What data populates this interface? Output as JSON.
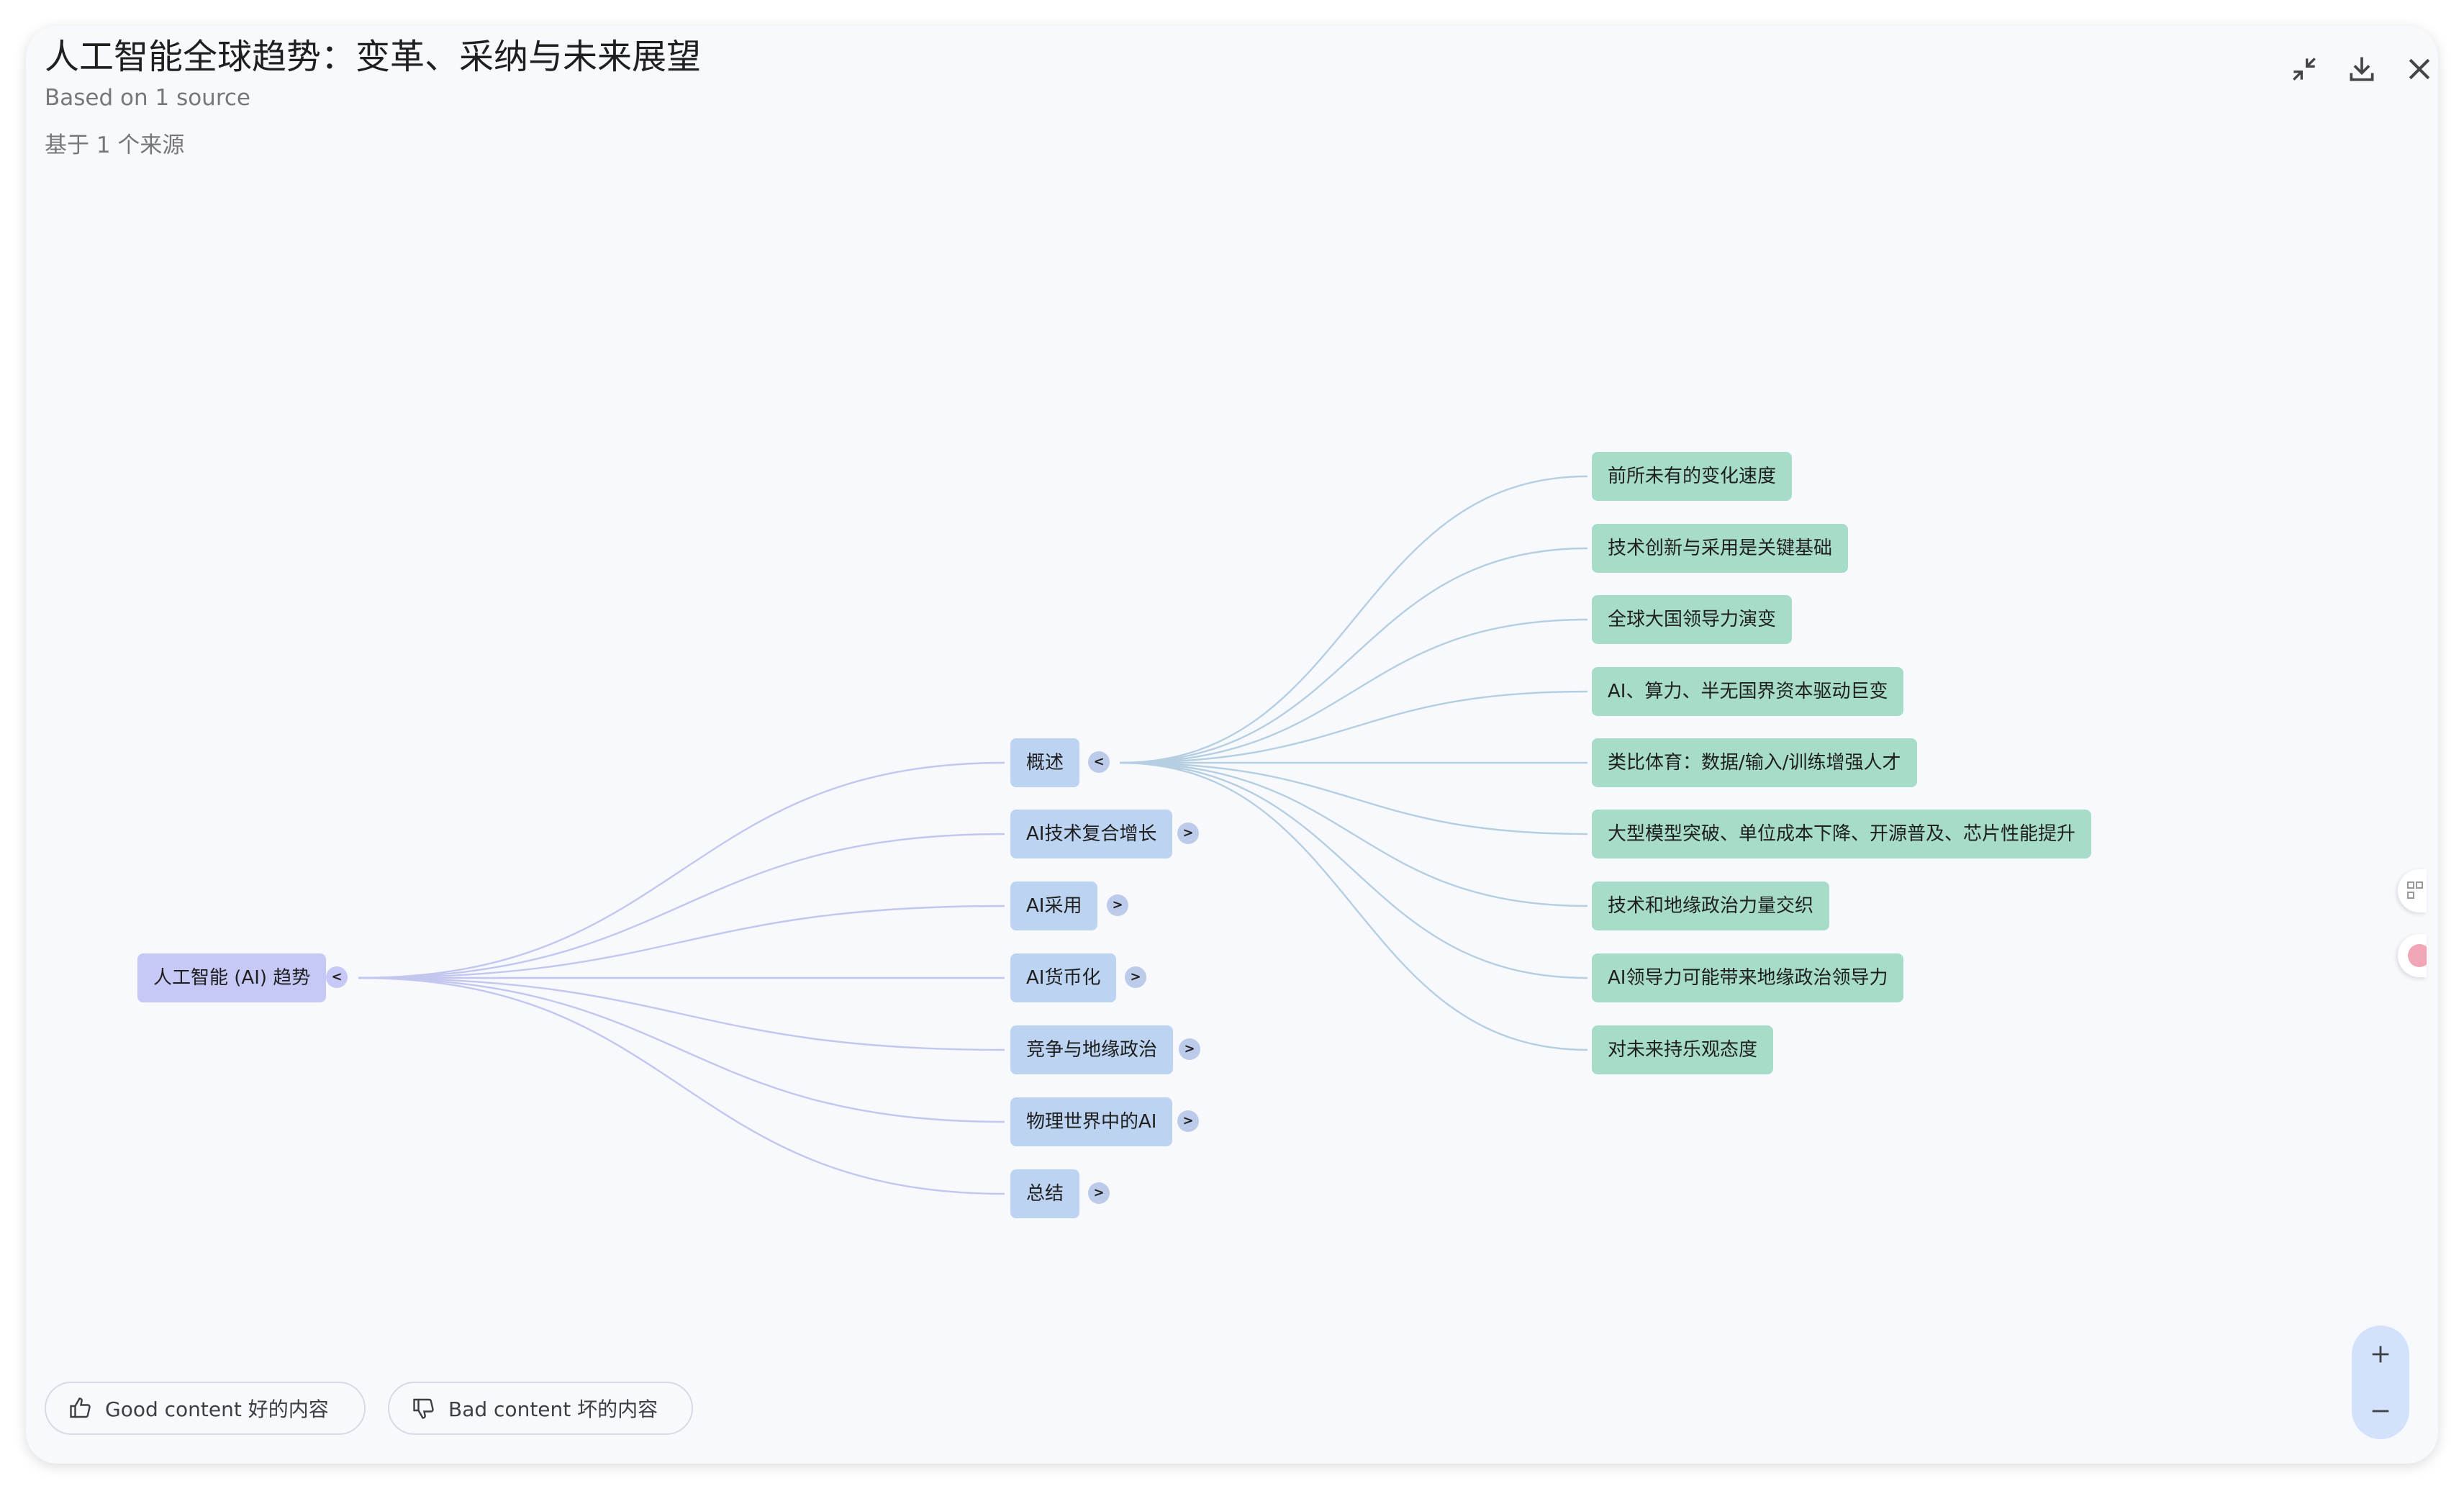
{
  "header": {
    "title": "人工智能全球趋势：变革、采纳与未来展望",
    "source_en": "Based on 1 source",
    "source_zh": "基于 1 个来源",
    "icons": [
      "collapse-icon",
      "download-icon",
      "close-icon"
    ]
  },
  "mindmap": {
    "root": {
      "label": "人工智能 (AI) 趋势",
      "toggle": "<"
    },
    "branches": [
      {
        "label": "概述",
        "toggle": "<"
      },
      {
        "label": "AI技术复合增长",
        "toggle": ">"
      },
      {
        "label": "AI采用",
        "toggle": ">"
      },
      {
        "label": "AI货币化",
        "toggle": ">"
      },
      {
        "label": "竞争与地缘政治",
        "toggle": ">"
      },
      {
        "label": "物理世界中的AI",
        "toggle": ">"
      },
      {
        "label": "总结",
        "toggle": ">"
      }
    ],
    "overview_children": [
      "前所未有的变化速度",
      "技术创新与采用是关键基础",
      "全球大国领导力演变",
      "AI、算力、半无国界资本驱动巨变",
      "类比体育：数据/输入/训练增强人才",
      "大型模型突破、单位成本下降、开源普及、芯片性能提升",
      "技术和地缘政治力量交织",
      "AI领导力可能带来地缘政治领导力",
      "对未来持乐观态度"
    ]
  },
  "feedback": {
    "good_label": "Good content  好的内容",
    "bad_label": "Bad content  坏的内容"
  },
  "zoom": {
    "zoom_in_label": "+",
    "zoom_out_label": "−"
  },
  "colors": {
    "root_node": "#c6c8f6",
    "branch_node": "#bcd3f2",
    "leaf_node": "#a6dcc8",
    "root_links": "#c3c6ef",
    "branch_links": "#b5cee2"
  }
}
